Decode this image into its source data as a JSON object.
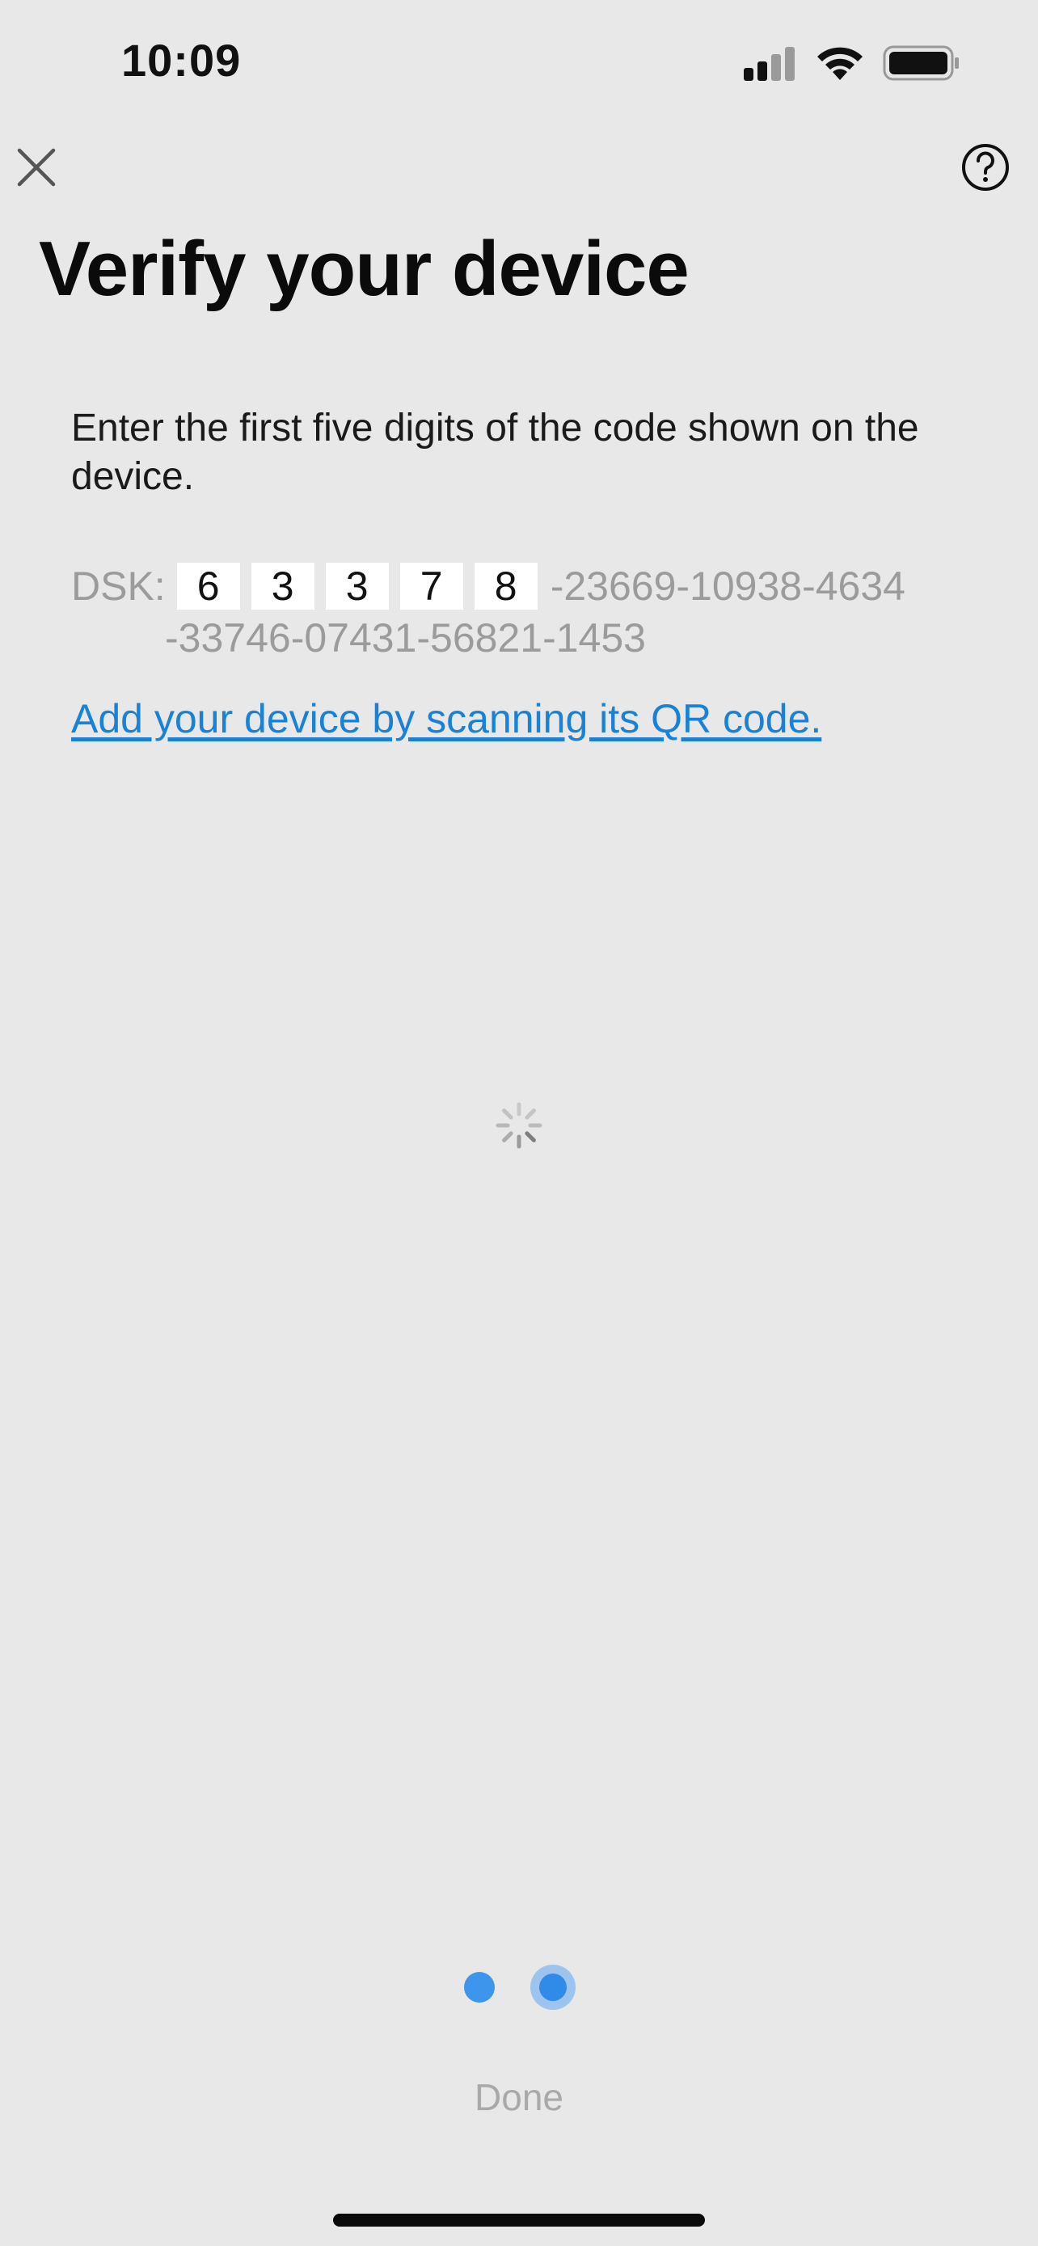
{
  "status_bar": {
    "time": "10:09",
    "icons": [
      "cellular-signal-icon",
      "wifi-icon",
      "battery-icon"
    ]
  },
  "nav": {
    "close_icon": "close-icon",
    "help_icon": "help-icon"
  },
  "page": {
    "title": "Verify your device",
    "instruction": "Enter the first five digits of the code shown on the device."
  },
  "dsk": {
    "label": "DSK:",
    "digits": [
      "6",
      "3",
      "3",
      "7",
      "8"
    ],
    "rest_line1": "-23669-10938-4634",
    "rest_line2": "-33746-07431-56821-1453"
  },
  "qr_link": {
    "label": "Add your device by scanning its QR code."
  },
  "loading": {
    "icon": "loading-spinner-icon"
  },
  "pager": {
    "total": 2,
    "current": 2
  },
  "footer": {
    "done_label": "Done"
  },
  "colors": {
    "background": "#e8e8e8",
    "link": "#1a82d6",
    "accent": "#2f8ae8",
    "muted_text": "#9b9b9b",
    "disabled": "#a9a9a9"
  }
}
